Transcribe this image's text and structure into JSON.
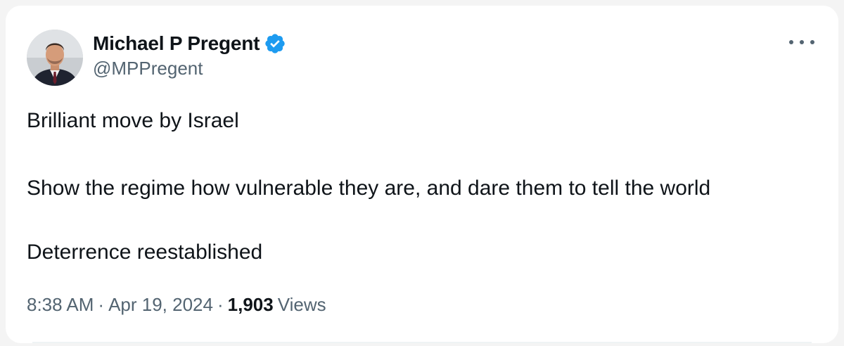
{
  "tweet": {
    "author": {
      "display_name": "Michael P Pregent",
      "handle": "@MPPregent",
      "verified": true,
      "verified_icon": "verified-badge-icon",
      "verified_color": "#1d9bf0"
    },
    "text_lines": [
      "Brilliant move by Israel",
      "Show the regime how vulnerable they are, and dare them to tell the world",
      "Deterrence reestablished"
    ],
    "meta": {
      "time": "8:38 AM",
      "separator": "·",
      "date": "Apr 19, 2024",
      "views_count": "1,903",
      "views_label": "Views"
    },
    "more_icon": "more-options-icon"
  }
}
